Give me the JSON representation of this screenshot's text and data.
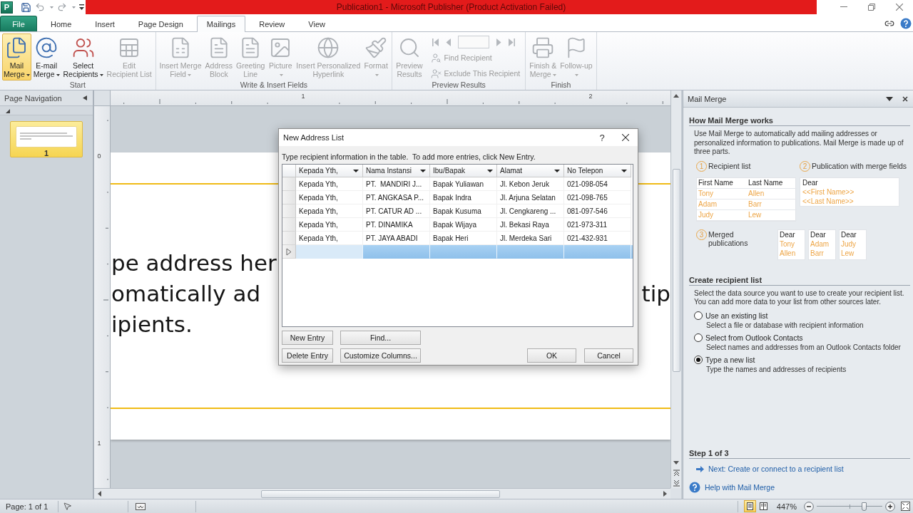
{
  "title_bar": {
    "app_icon": "P",
    "title": "Publication1 - Microsoft Publisher (Product Activation Failed)"
  },
  "tabs": [
    {
      "label": "File",
      "kind": "file",
      "selected": false
    },
    {
      "label": "Home",
      "kind": "tab",
      "selected": false
    },
    {
      "label": "Insert",
      "kind": "tab",
      "selected": false
    },
    {
      "label": "Page Design",
      "kind": "tab",
      "selected": false
    },
    {
      "label": "Mailings",
      "kind": "tab",
      "selected": true
    },
    {
      "label": "Review",
      "kind": "tab",
      "selected": false
    },
    {
      "label": "View",
      "kind": "tab",
      "selected": false
    }
  ],
  "ribbon": {
    "groups": [
      {
        "label": "Start",
        "buttons": [
          {
            "lines": [
              "Mail",
              "Merge"
            ],
            "dropdown": true,
            "pressed": true,
            "disabled": false
          },
          {
            "lines": [
              "E-mail",
              "Merge"
            ],
            "dropdown": true,
            "pressed": false,
            "disabled": false
          },
          {
            "lines": [
              "Select",
              "Recipients"
            ],
            "dropdown": true,
            "pressed": false,
            "disabled": false
          },
          {
            "lines": [
              "Edit",
              "Recipient List"
            ],
            "dropdown": false,
            "pressed": false,
            "disabled": true
          }
        ]
      },
      {
        "label": "Write & Insert Fields",
        "buttons": [
          {
            "lines": [
              "Insert Merge",
              "Field"
            ],
            "dropdown": true,
            "pressed": false,
            "disabled": true
          },
          {
            "lines": [
              "Address",
              "Block"
            ],
            "dropdown": false,
            "pressed": false,
            "disabled": true
          },
          {
            "lines": [
              "Greeting",
              "Line"
            ],
            "dropdown": false,
            "pressed": false,
            "disabled": true
          },
          {
            "lines": [
              "Picture"
            ],
            "dropdown": true,
            "pressed": false,
            "disabled": true
          },
          {
            "lines": [
              "Insert Personalized",
              "Hyperlink"
            ],
            "dropdown": false,
            "pressed": false,
            "disabled": true
          },
          {
            "lines": [
              "Format"
            ],
            "dropdown": true,
            "pressed": false,
            "disabled": true
          }
        ]
      },
      {
        "label": "Preview Results",
        "buttons": [
          {
            "lines": [
              "Preview",
              "Results"
            ],
            "dropdown": false,
            "pressed": false,
            "disabled": true
          }
        ],
        "navigator": {
          "disabled": true
        },
        "commands": [
          {
            "label": "Find Recipient",
            "disabled": true
          },
          {
            "label": "Exclude This Recipient",
            "disabled": true
          }
        ]
      },
      {
        "label": "Finish",
        "buttons": [
          {
            "lines": [
              "Finish &",
              "Merge"
            ],
            "dropdown": true,
            "pressed": false,
            "disabled": true
          },
          {
            "lines": [
              "Follow-up"
            ],
            "dropdown": true,
            "pressed": false,
            "disabled": true
          }
        ]
      }
    ]
  },
  "nav_pane": {
    "title": "Page Navigation",
    "pages": [
      {
        "number": "1",
        "selected": true
      }
    ]
  },
  "rulers": {
    "horizontal": [
      "1",
      "2"
    ],
    "vertical": [
      "0",
      "1"
    ]
  },
  "document": {
    "lines": [
      {
        "left": "pe address her"
      },
      {
        "left": "omatically ad",
        "right": "tip"
      },
      {
        "left": "ipients."
      }
    ]
  },
  "dialog": {
    "title": "New Address List",
    "help": "?",
    "instruction": "Type recipient information in the table.  To add more entries, click New Entry.",
    "columns": [
      "Kepada Yth,",
      "Nama Instansi",
      "Ibu/Bapak",
      "Alamat",
      "No Telepon"
    ],
    "rows": [
      {
        "cells": [
          "Kepada Yth,",
          "PT.  MANDIRI J...",
          "Bapak Yuliawan",
          "Jl. Kebon Jeruk",
          "021-098-054"
        ],
        "selected": false
      },
      {
        "cells": [
          "Kepada Yth,",
          "PT. ANGKASA P...",
          "Bapak Indra",
          "Jl. Arjuna Selatan",
          "021-098-765"
        ],
        "selected": false
      },
      {
        "cells": [
          "Kepada Yth,",
          "PT. CATUR AD ...",
          "Bapak Kusuma",
          "Jl. Cengkareng ...",
          "081-097-546"
        ],
        "selected": false
      },
      {
        "cells": [
          "Kepada Yth,",
          "PT. DINAMIKA",
          "Bapak Wijaya",
          "Jl. Bekasi Raya",
          "021-973-311"
        ],
        "selected": false
      },
      {
        "cells": [
          "Kepada Yth,",
          "PT. JAYA ABADI",
          "Bapak Heri",
          "Jl. Merdeka Sari",
          "021-432-931"
        ],
        "selected": false
      },
      {
        "selected": true
      }
    ],
    "left_buttons": [
      "New Entry",
      "Find...",
      "Delete Entry",
      "Customize Columns..."
    ],
    "right_buttons": [
      "OK",
      "Cancel"
    ]
  },
  "task_pane": {
    "title": "Mail Merge",
    "how_it_works": {
      "heading": "How Mail Merge works",
      "text": "Use Mail Merge to automatically add mailing addresses or personalized information to publications. Mail Merge is made up of three parts.",
      "steps": [
        {
          "number": "1",
          "label": "Recipient list"
        },
        {
          "number": "2",
          "label": "Publication with merge fields"
        },
        {
          "number": "3",
          "label": "Merged publications"
        }
      ],
      "recipient_table": {
        "columns": [
          "First Name",
          "Last Name"
        ],
        "rows": [
          [
            "Tony",
            "Allen"
          ],
          [
            "Adam",
            "Barr"
          ],
          [
            "Judy",
            "Lew"
          ]
        ]
      },
      "merge_document": [
        "Dear",
        "<<First Name>>",
        "<<Last Name>>"
      ],
      "merged_documents": [
        [
          "Dear",
          "Tony",
          "Allen"
        ],
        [
          "Dear",
          "Adam",
          "Barr"
        ],
        [
          "Dear",
          "Judy",
          "Lew"
        ]
      ]
    },
    "create_list": {
      "heading": "Create recipient list",
      "text": "Select the data source you want to use to create your recipient list. You can add more data to your list from other sources later.",
      "options": [
        {
          "label": "Use an existing list",
          "description": "Select a file or database with recipient information",
          "selected": false
        },
        {
          "label": "Select from Outlook Contacts",
          "description": "Select names and addresses from an Outlook Contacts folder",
          "selected": false
        },
        {
          "label": "Type a new list",
          "description": "Type the names and addresses of recipients",
          "selected": true
        }
      ]
    },
    "footer": {
      "heading": "Step 1 of 3",
      "next_link": "Next: Create or connect to a recipient list",
      "help_link": "Help with Mail Merge"
    }
  },
  "status_bar": {
    "page": "Page: 1 of 1",
    "views": [
      {
        "selected": true
      },
      {
        "selected": false
      }
    ],
    "zoom": "447%",
    "zoom_slider": {
      "level": 0.72
    }
  }
}
